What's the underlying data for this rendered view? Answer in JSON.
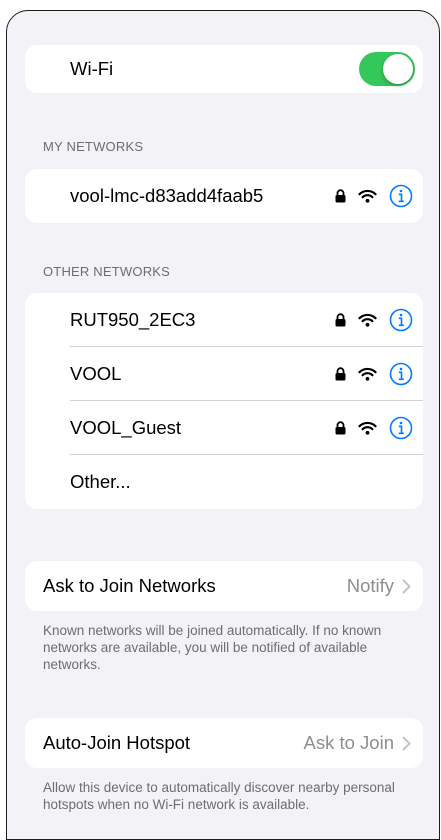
{
  "colors": {
    "accent": "#007aff",
    "toggle_on": "#34c759",
    "background": "#f2f2f7",
    "card": "#ffffff",
    "secondary_text": "#8e8e93",
    "header_text": "#6d6d72"
  },
  "wifi": {
    "label": "Wi-Fi",
    "enabled": true
  },
  "my_networks": {
    "header": "MY NETWORKS",
    "items": [
      {
        "ssid": "vool-lmc-d83add4faab5",
        "secured": true,
        "icons": [
          "lock-icon",
          "wifi-signal-icon",
          "info-icon"
        ]
      }
    ]
  },
  "other_networks": {
    "header": "OTHER NETWORKS",
    "items": [
      {
        "ssid": "RUT950_2EC3",
        "secured": true,
        "icons": [
          "lock-icon",
          "wifi-signal-icon",
          "info-icon"
        ]
      },
      {
        "ssid": "VOOL",
        "secured": true,
        "icons": [
          "lock-icon",
          "wifi-signal-icon",
          "info-icon"
        ]
      },
      {
        "ssid": "VOOL_Guest",
        "secured": true,
        "icons": [
          "lock-icon",
          "wifi-signal-icon",
          "info-icon"
        ]
      }
    ],
    "other_label": "Other..."
  },
  "ask_to_join": {
    "label": "Ask to Join Networks",
    "value": "Notify",
    "footer": "Known networks will be joined automatically. If no known networks are available, you will be notified of available networks."
  },
  "auto_join_hotspot": {
    "label": "Auto-Join Hotspot",
    "value": "Ask to Join",
    "footer": "Allow this device to automatically discover nearby personal hotspots when no Wi-Fi network is available."
  }
}
